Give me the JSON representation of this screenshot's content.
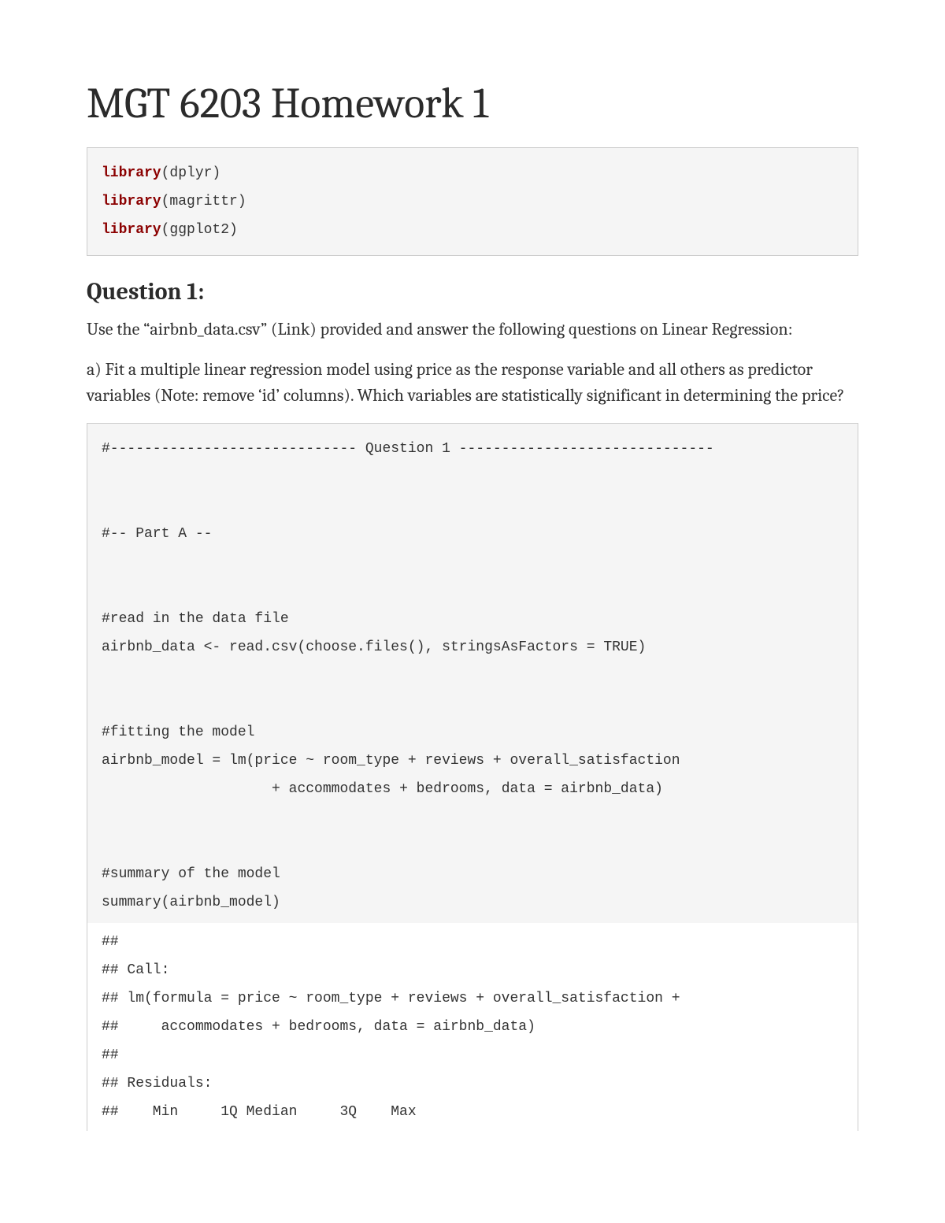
{
  "title": "MGT 6203 Homework 1",
  "lib_block": {
    "kw": "library",
    "pkg1": "(dplyr)",
    "pkg2": "(magrittr)",
    "pkg3": "(ggplot2)"
  },
  "question_heading": "Question 1:",
  "intro_text": "Use the “airbnb_data.csv” (Link) provided and answer the following questions on Linear Regression:",
  "part_a_text": "a) Fit a multiple linear regression model using price as the response variable and all others as predictor variables (Note: remove ‘id’ columns). Which variables are statistically significant in determining the price?",
  "code2": {
    "c_q1": "#----------------------------- Question 1 ------------------------------",
    "c_parta": "#-- Part A --",
    "c_read": "#read in the data file",
    "l_read_a": "airbnb_data <- read.csv(choose.files(), stringsAsFactors = ",
    "l_read_const": "TRUE",
    "l_read_b": ")",
    "c_fit": "#fitting the model",
    "l_fit1": "airbnb_model = lm(price ~ room_type + reviews + overall_satisfaction",
    "l_fit2": "                    + accommodates + bedrooms, data = airbnb_data)",
    "c_sum": "#summary of the model",
    "l_sum": "summary(airbnb_model)"
  },
  "output": {
    "l1": "## ",
    "l2": "## Call:",
    "l3": "## lm(formula = price ~ room_type + reviews + overall_satisfaction + ",
    "l4": "##     accommodates + bedrooms, data = airbnb_data)",
    "l5": "## ",
    "l6": "## Residuals:",
    "l7": "##    Min     1Q Median     3Q    Max "
  }
}
